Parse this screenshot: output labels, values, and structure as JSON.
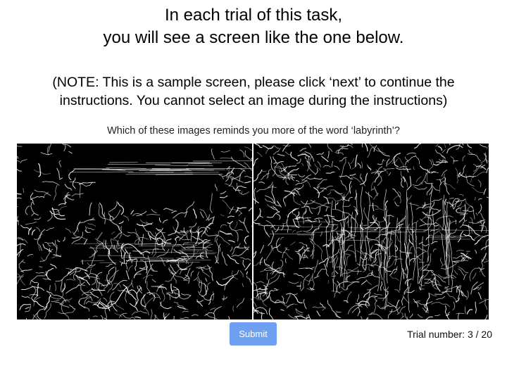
{
  "instructions": {
    "heading_line_1": "In each trial of this task,",
    "heading_line_2": "you will see a screen like the one below.",
    "note_line_1": "(NOTE: This is a sample screen, please click ‘next’ to continue the",
    "note_line_2": "instructions. You cannot select an image during the instructions)"
  },
  "trial": {
    "prompt": "Which of these images reminds you more of the word ‘labyrinth’?",
    "submit_label": "Submit",
    "trial_counter": "Trial number: 3 / 20"
  },
  "colors": {
    "submit_button": "#6e9ff0",
    "image_background": "#000000",
    "edge_lines": "#ffffff"
  }
}
